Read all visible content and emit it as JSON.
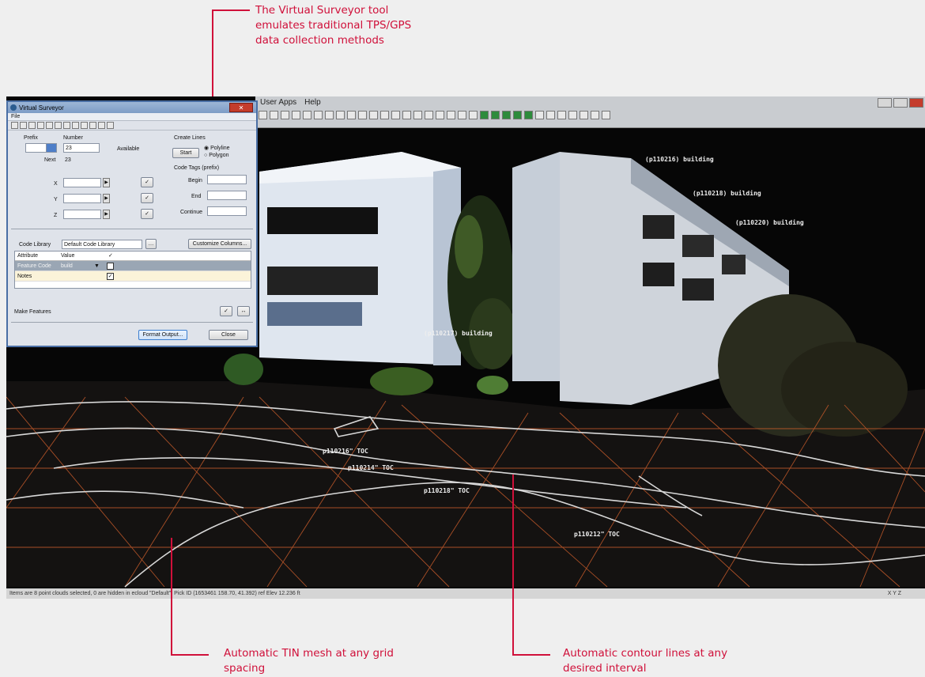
{
  "callouts": {
    "top": [
      "The Virtual Surveyor tool",
      "emulates traditional TPS/GPS",
      "data collection methods"
    ],
    "bottom_left": [
      "Automatic TIN mesh at any grid",
      "spacing"
    ],
    "bottom_right": [
      "Automatic contour lines at any",
      "desired interval"
    ]
  },
  "app": {
    "menu": [
      "User Apps",
      "Help"
    ]
  },
  "dialog": {
    "title": "Virtual Surveyor",
    "menu_file": "File",
    "prefix_label": "Prefix",
    "number_label": "Number",
    "number_value": "23",
    "available_label": "Available",
    "next_label": "Next",
    "next_value": "23",
    "create_lines_label": "Create Lines",
    "start_button": "Start",
    "polyline_option": "Polyline",
    "polygon_option": "Polygon",
    "code_tags_label": "Code Tags (prefix)",
    "begin_label": "Begin",
    "end_label": "End",
    "continue_label": "Continue",
    "x_label": "X",
    "y_label": "Y",
    "z_label": "Z",
    "code_library_label": "Code Library",
    "code_library_value": "Default Code Library",
    "customize_button": "Customize Columns...",
    "table_headers": [
      "Attribute",
      "Value"
    ],
    "rows": [
      {
        "attribute": "Feature Code",
        "value": "build"
      },
      {
        "attribute": "Notes",
        "value": ""
      }
    ],
    "make_features_label": "Make Features",
    "format_output_button": "Format Output...",
    "close_button": "Close"
  },
  "scene_labels": {
    "buildings": [
      "(p110216) building",
      "(p110218) building",
      "(p110220) building",
      "(p110217) building"
    ],
    "contours": [
      "p110216\" TOC",
      "p110214\" TOC",
      "p110218\" TOC",
      "p110212\" TOC"
    ]
  },
  "status": {
    "left": "Items are 8 point clouds selected, 0 are hidden in ecloud \"Default\". Pick ID (1653461 158.70, 41.392) ref Elev 12.236 ft",
    "right": "X Y Z"
  },
  "colors": {
    "accent": "#d0103a",
    "mesh": "#c45a2a",
    "contour": "#d8d8d8"
  }
}
